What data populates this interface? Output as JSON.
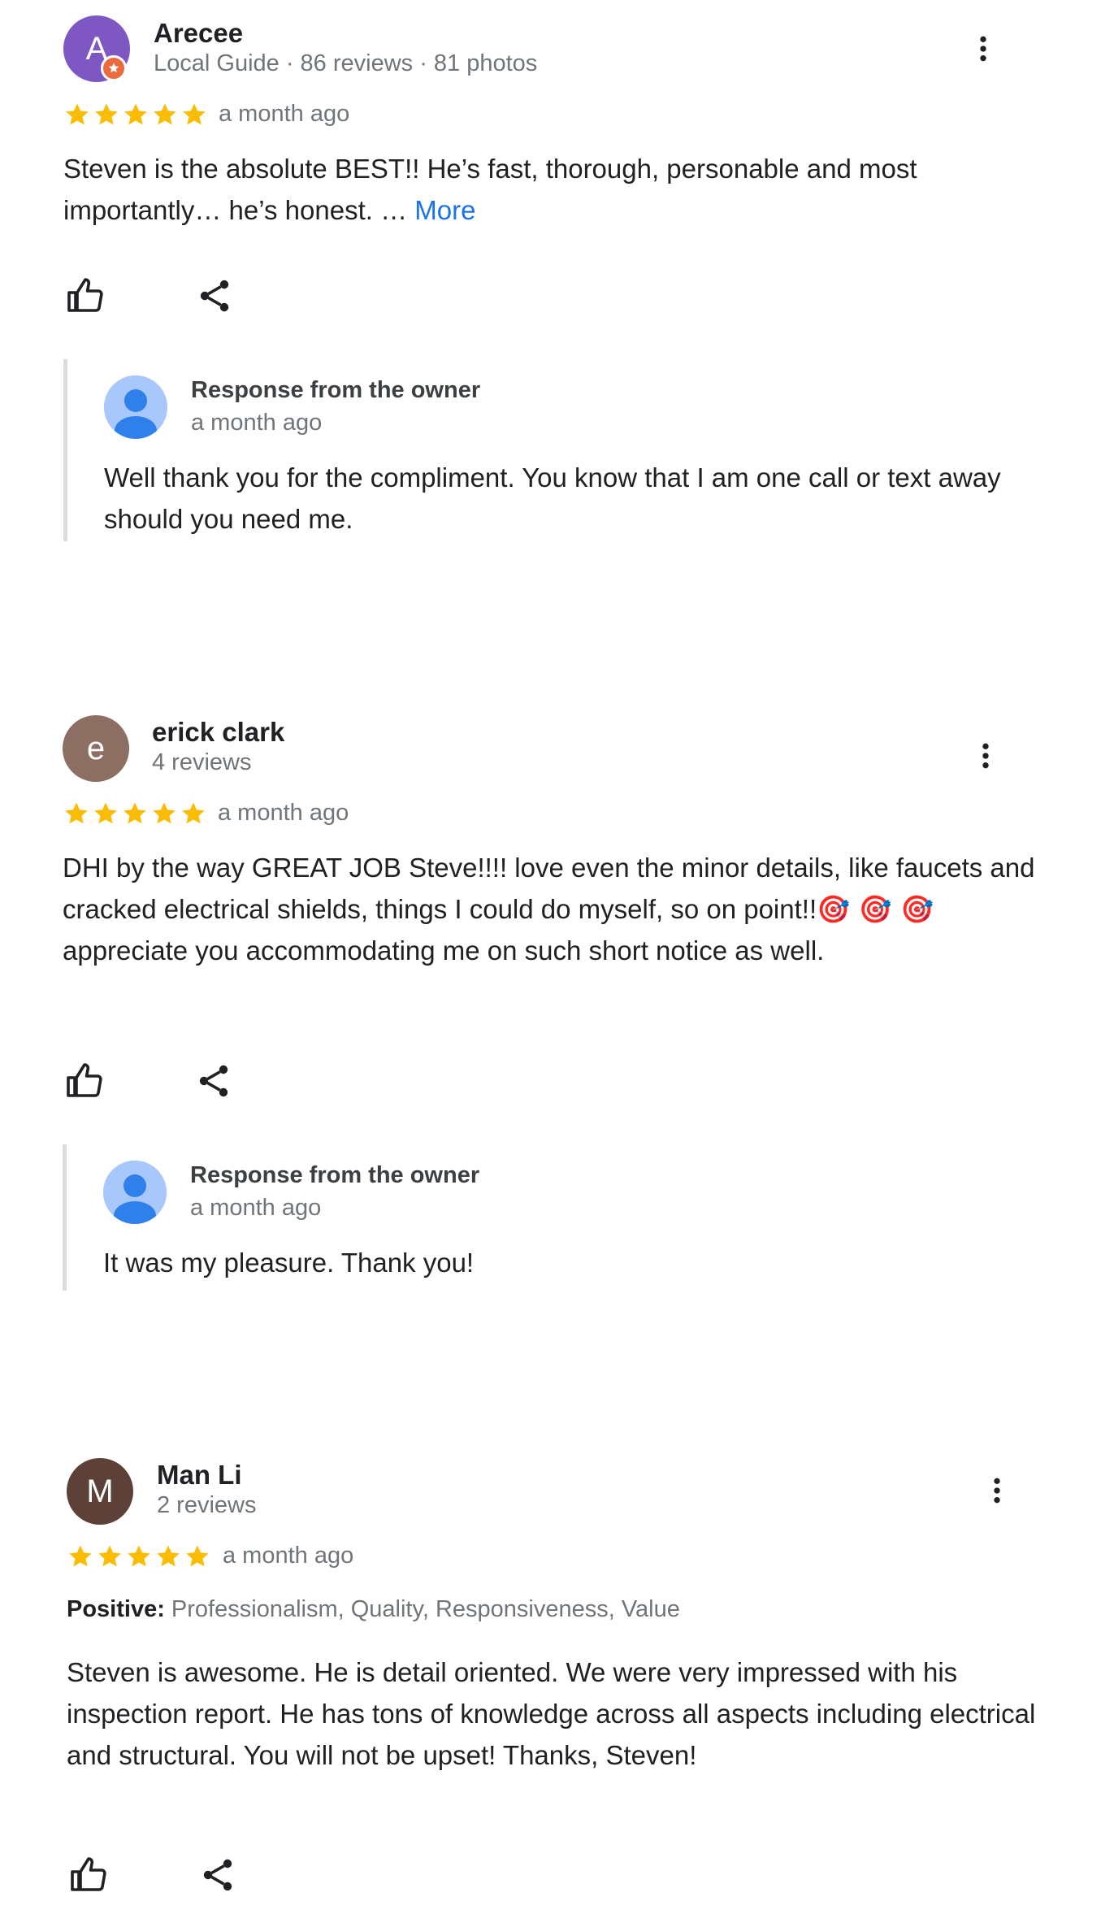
{
  "reviews": [
    {
      "name": "Arecee",
      "avatar_letter": "A",
      "avatar_color": "#7e57c2",
      "meta": "Local Guide · 86 reviews · 81 photos",
      "rating": 5,
      "date": "a month ago",
      "text": "Steven is the absolute BEST!! He’s fast, thorough, personable and most importantly… he’s honest. … ",
      "more_label": "More",
      "owner_response": {
        "label": "Response from the owner",
        "date": "a month ago",
        "text": "Well thank you for the compliment. You know that I am one call or text away should you need me."
      }
    },
    {
      "name": "erick clark",
      "avatar_letter": "e",
      "avatar_color": "#8d6e63",
      "meta": "4 reviews",
      "rating": 5,
      "date": "a month ago",
      "text_part1": "DHI by the way GREAT JOB Steve!!!! love even the minor details, like faucets and cracked electrical shields, things I could do myself, so on point!!",
      "emojis": "🎯 🎯 🎯",
      "text_part2": " appreciate you accommodating me on such short notice as well.",
      "owner_response": {
        "label": "Response from the owner",
        "date": "a month ago",
        "text": "It was my pleasure. Thank you!"
      }
    },
    {
      "name": "Man Li",
      "avatar_letter": "M",
      "avatar_color": "#5d4037",
      "meta": "2 reviews",
      "rating": 5,
      "date": "a month ago",
      "positive_label": "Positive:",
      "positive_values": " Professionalism, Quality, Responsiveness, Value",
      "text": "Steven is awesome. He is detail oriented. We were very impressed with his inspection report. He has tons of knowledge across all aspects including electrical and structural. You will not be upset! Thanks, Steven!"
    }
  ],
  "icons": {
    "star": "star-icon",
    "like": "thumbs-up-icon",
    "share": "share-icon",
    "menu": "more-vert-icon",
    "guide": "local-guide-badge-icon",
    "owner": "person-icon"
  },
  "colors": {
    "star": "#fbbc04",
    "link": "#1a73e8",
    "secondary_text": "#70757a"
  }
}
